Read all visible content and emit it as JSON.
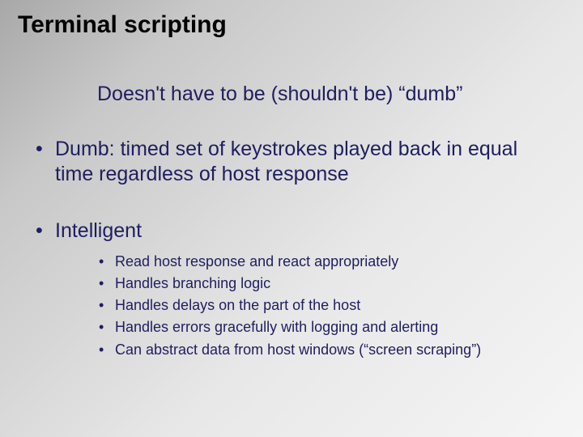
{
  "slide": {
    "title": "Terminal scripting",
    "subtitle": "Doesn't have to be (shouldn't be) “dumb”",
    "bullets": [
      {
        "text": "Dumb: timed set of keystrokes played back in equal time regardless of host response"
      },
      {
        "text": "Intelligent",
        "subbullets": [
          "Read host response and react appropriately",
          "Handles branching logic",
          "Handles delays on the part of the host",
          "Handles errors gracefully with logging and alerting",
          "Can abstract data from host windows (“screen scraping”)"
        ]
      }
    ]
  }
}
